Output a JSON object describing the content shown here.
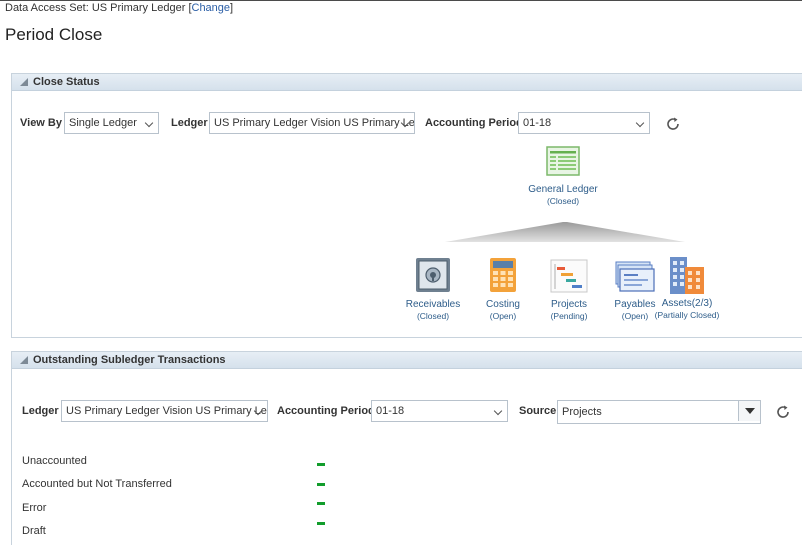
{
  "data_access": {
    "label": "Data Access Set:",
    "value": "US Primary Ledger",
    "change": "Change"
  },
  "page_title": "Period Close",
  "close_status": {
    "title": "Close Status",
    "view_by_label": "View By",
    "view_by_value": "Single Ledger",
    "ledger_label": "Ledger",
    "ledger_value": "US Primary Ledger Vision US Primary Le",
    "period_label": "Accounting Period",
    "period_value": "01-18",
    "general_ledger": {
      "name": "General Ledger",
      "status": "(Closed)"
    },
    "modules": [
      {
        "name": "Receivables",
        "status": "(Closed)",
        "icon": "safe-icon"
      },
      {
        "name": "Costing",
        "status": "(Open)",
        "icon": "calculator-icon"
      },
      {
        "name": "Projects",
        "status": "(Pending)",
        "icon": "gantt-chart-icon"
      },
      {
        "name": "Payables",
        "status": "(Open)",
        "icon": "checks-icon"
      },
      {
        "name": "Assets(2/3)",
        "status": "(Partially Closed)",
        "icon": "buildings-icon"
      }
    ]
  },
  "outstanding": {
    "title": "Outstanding Subledger Transactions",
    "ledger_label": "Ledger",
    "ledger_value": "US Primary Ledger Vision US Primary Le",
    "period_label": "Accounting Period",
    "period_value": "01-18",
    "source_label": "Source",
    "source_value": "Projects",
    "rows": [
      "Unaccounted",
      "Accounted but Not Transferred",
      "Error",
      "Draft"
    ]
  },
  "colors": {
    "link": "#2a5ea6",
    "accent_green": "#129d2c",
    "header_bg": "#dde7f0"
  }
}
